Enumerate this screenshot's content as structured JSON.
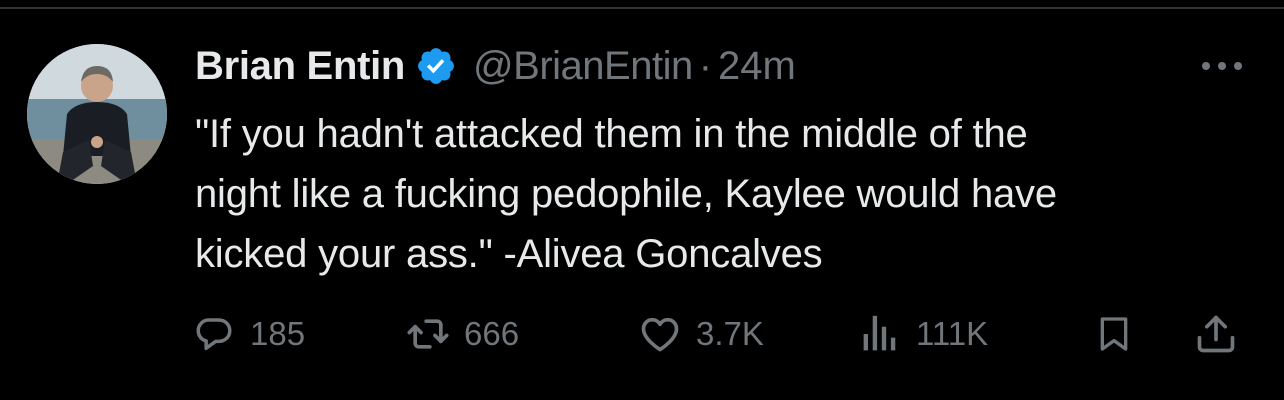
{
  "tweet": {
    "author": {
      "display_name": "Brian Entin",
      "handle": "@BrianEntin",
      "verified_icon": "verified-badge-icon",
      "avatar": "avatar-photo"
    },
    "separator": "·",
    "timestamp": "24m",
    "more_icon": "more-horizontal-icon",
    "text_lines": [
      "\"If you hadn't attacked them in the middle of the",
      "night like a fucking pedophile, Kaylee would have",
      "kicked your ass.\" -Alivea Goncalves"
    ],
    "actions": {
      "reply": {
        "icon": "reply-icon",
        "count": "185"
      },
      "retweet": {
        "icon": "retweet-icon",
        "count": "666"
      },
      "like": {
        "icon": "heart-icon",
        "count": "3.7K"
      },
      "views": {
        "icon": "views-icon",
        "count": "111K"
      },
      "bookmark": {
        "icon": "bookmark-icon"
      },
      "share": {
        "icon": "share-icon"
      }
    }
  },
  "colors": {
    "background": "#000000",
    "text": "#e7e9ea",
    "secondary": "#71767b",
    "verified": "#1d9bf0",
    "divider": "#2f3336"
  }
}
